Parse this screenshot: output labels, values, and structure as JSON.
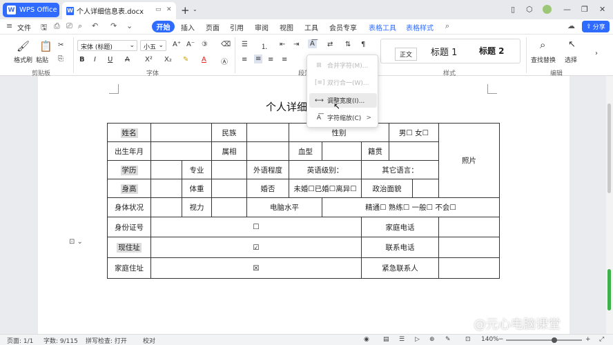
{
  "titlebar": {
    "wps_label": "WPS Office",
    "doc_tab_title": "个人详细信息表.docx",
    "new_tab": "+",
    "tab_list": "⌄"
  },
  "menubar": {
    "file": "文件",
    "items": [
      "开始",
      "插入",
      "页面",
      "引用",
      "审阅",
      "视图",
      "工具",
      "会员专享"
    ],
    "contextual": [
      "表格工具",
      "表格样式"
    ],
    "share": "分享"
  },
  "ribbon": {
    "clipboard": {
      "format_painter": "格式刷",
      "paste": "粘贴",
      "group": "剪贴板"
    },
    "font": {
      "name": "宋体 (标题)",
      "size": "小五",
      "group": "字体"
    },
    "paragraph": {
      "group": "段落"
    },
    "styles": {
      "normal": "正文",
      "h1": "标题 1",
      "h2": "标题 2",
      "group": "样式"
    },
    "editing": {
      "find_replace": "查找替换",
      "select": "选择",
      "group": "编辑"
    }
  },
  "document": {
    "title": "个人详细",
    "table": {
      "r1": [
        "姓名",
        "",
        "民族",
        "",
        "性别",
        "男☐  女☐",
        "照片"
      ],
      "r2": [
        "出生年月",
        "",
        "属相",
        "",
        "血型",
        "",
        "籍贯",
        ""
      ],
      "r3": [
        "学历",
        "",
        "专业",
        "",
        "外语程度",
        "英语级别：",
        "其它语言："
      ],
      "r4": [
        "身高",
        "",
        "体重",
        "",
        "婚否",
        "未婚☐已婚☐离异☐",
        "政治面貌",
        ""
      ],
      "r5": [
        "身体状况",
        "",
        "视力",
        "",
        "电脑水平",
        "精通☐  熟练☐  一般☐  不会☐"
      ],
      "r6": [
        "身份证号",
        "☐",
        "家庭电话",
        ""
      ],
      "r7": [
        "现住址",
        "☑",
        "联系电话",
        ""
      ],
      "r8": [
        "家庭住址",
        "☒",
        "紧急联系人",
        ""
      ]
    }
  },
  "dropdown": {
    "items": [
      "合并字符(M)...",
      "双行合一(W)...",
      "调整宽度(I)...",
      "字符缩放(C)"
    ],
    "arrow": ">"
  },
  "statusbar": {
    "page": "页面: 1/1",
    "words": "字数: 9/115",
    "spell": "拼写检查: 打开",
    "proof": "校对",
    "zoom": "140%"
  },
  "watermark": "@元心电脑课堂",
  "colors": {
    "accent": "#2f6bff",
    "highlight": "#dcdcdc"
  }
}
